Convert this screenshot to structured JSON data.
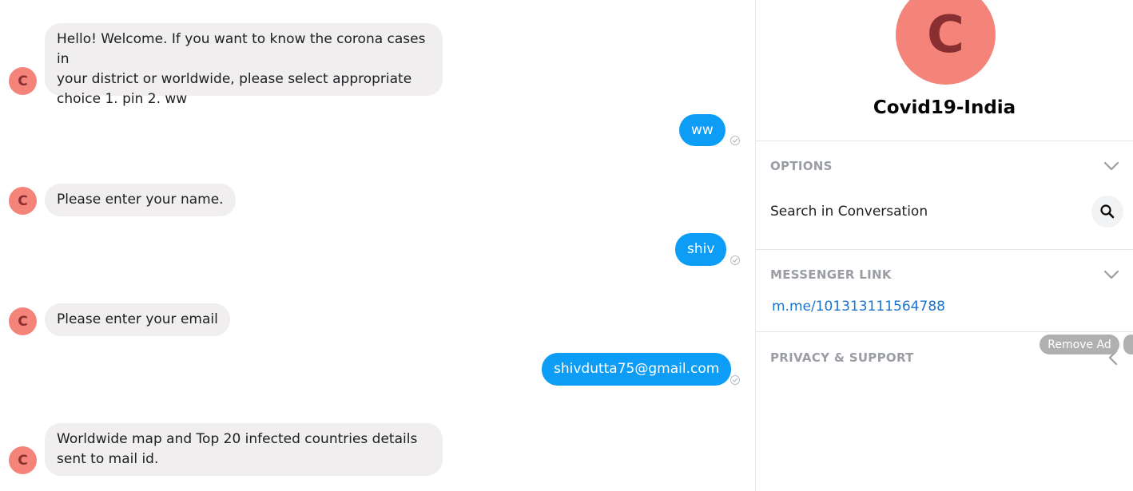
{
  "conversation": {
    "bot_initial": "C",
    "messages": [
      {
        "from": "bot",
        "text": "Hello! Welcome. If you want to know the corona cases in\nyour district or worldwide, please select appropriate\nchoice  1. pin  2. ww"
      },
      {
        "from": "user",
        "text": "ww"
      },
      {
        "from": "bot",
        "text": "Please enter your name."
      },
      {
        "from": "user",
        "text": "shiv"
      },
      {
        "from": "bot",
        "text": "Please enter your email"
      },
      {
        "from": "user",
        "text": "shivdutta75@gmail.com"
      },
      {
        "from": "bot",
        "text": "Worldwide map and Top 20 infected countries details\nsent to mail id."
      }
    ]
  },
  "info_panel": {
    "avatar_initial": "C",
    "page_name": "Covid19-India",
    "options": {
      "title": "OPTIONS",
      "search_label": "Search in Conversation"
    },
    "messenger_link": {
      "title": "MESSENGER LINK",
      "url_text": "m.me/101313111564788"
    },
    "privacy": {
      "title": "PRIVACY & SUPPORT"
    },
    "ad": {
      "remove_label": "Remove Ad"
    }
  },
  "colors": {
    "bot_avatar_bg": "#f4837a",
    "bot_avatar_fg": "#8a2f31",
    "user_bubble": "#0d9cf6",
    "bot_bubble": "#f0eeef",
    "link": "#1a73cd"
  }
}
